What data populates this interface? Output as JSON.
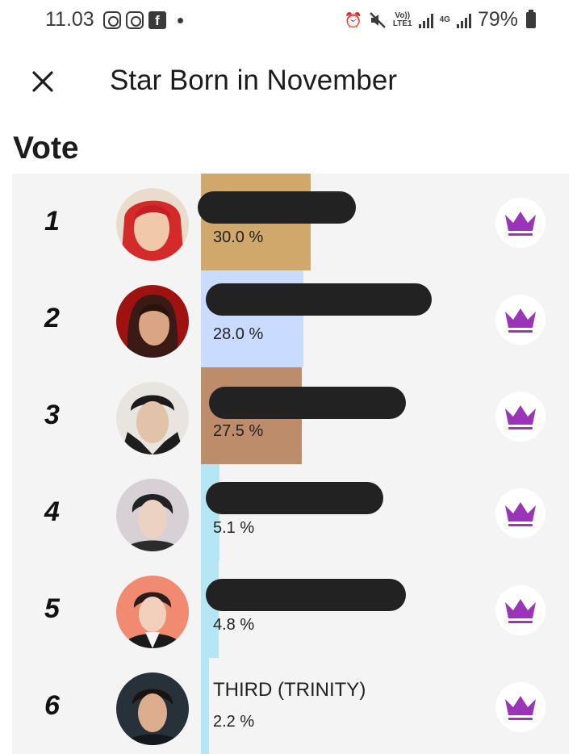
{
  "status_bar": {
    "time": "11.03",
    "network_volte": "Vo))",
    "network_lte": "LTE1",
    "network_4g": "4G",
    "battery": "79%",
    "icons": [
      "instagram-icon",
      "instagram-icon",
      "facebook-icon",
      "alarm-icon",
      "mute-icon",
      "signal-icon",
      "signal-icon",
      "battery-icon"
    ]
  },
  "header": {
    "title": "Star Born in November",
    "close_icon": "close-icon"
  },
  "section": {
    "title": "Vote"
  },
  "colors": {
    "crown": "#9b35b7",
    "bar_1": "#d1a86b",
    "bar_2": "#c9dcff",
    "bar_3": "#bd8c6a",
    "bar_4": "#b5e6f6",
    "bar_5": "#b5e6f6",
    "bar_6": "#b5e6f6"
  },
  "ranking": [
    {
      "rank": "1",
      "name": "",
      "percent": "30.0 %",
      "share": 30.0
    },
    {
      "rank": "2",
      "name": "",
      "percent": "28.0 %",
      "share": 28.0
    },
    {
      "rank": "3",
      "name": "",
      "percent": "27.5 %",
      "share": 27.5
    },
    {
      "rank": "4",
      "name": "",
      "percent": "5.1 %",
      "share": 5.1
    },
    {
      "rank": "5",
      "name": "",
      "percent": "4.8 %",
      "share": 4.8
    },
    {
      "rank": "6",
      "name": "THIRD (TRINITY)",
      "percent": "2.2 %",
      "share": 2.2
    }
  ]
}
